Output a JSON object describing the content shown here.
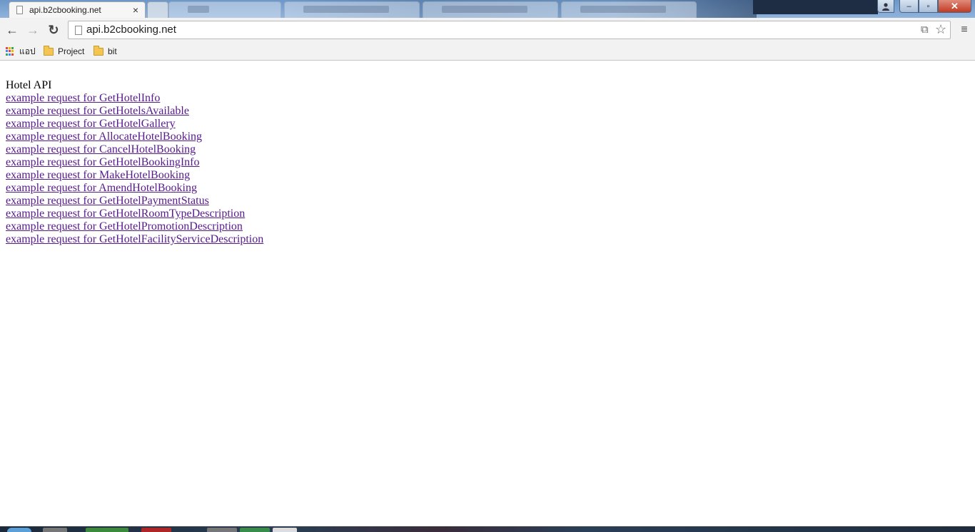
{
  "browser": {
    "active_tab": {
      "title": "api.b2cbooking.net",
      "close_glyph": "×"
    },
    "window_buttons": {
      "minimize": "–",
      "maximize": "▫",
      "close": "✕"
    },
    "toolbar": {
      "back_glyph": "←",
      "forward_glyph": "→",
      "reload_glyph": "↻",
      "url": "api.b2cbooking.net",
      "translate_glyph": "⧉",
      "star_glyph": "☆",
      "menu_glyph": "≡"
    },
    "bookmarks": [
      {
        "label": "แอป",
        "icon": "apps-grid-icon"
      },
      {
        "label": "Project",
        "icon": "folder-icon"
      },
      {
        "label": "bit",
        "icon": "folder-icon"
      }
    ],
    "colors": {
      "link": "#551a8b",
      "titlebar": "#8fb3dc"
    }
  },
  "page": {
    "heading": "Hotel API",
    "links": [
      "example request for GetHotelInfo",
      "example request for GetHotelsAvailable",
      "example request for GetHotelGallery",
      "example request for AllocateHotelBooking",
      "example request for CancelHotelBooking",
      "example request for GetHotelBookingInfo",
      "example request for MakeHotelBooking",
      "example request for AmendHotelBooking",
      "example request for GetHotelPaymentStatus",
      "example request for GetHotelRoomTypeDescription",
      "example request for GetHotelPromotionDescription",
      "example request for GetHotelFacilityServiceDescription"
    ]
  }
}
